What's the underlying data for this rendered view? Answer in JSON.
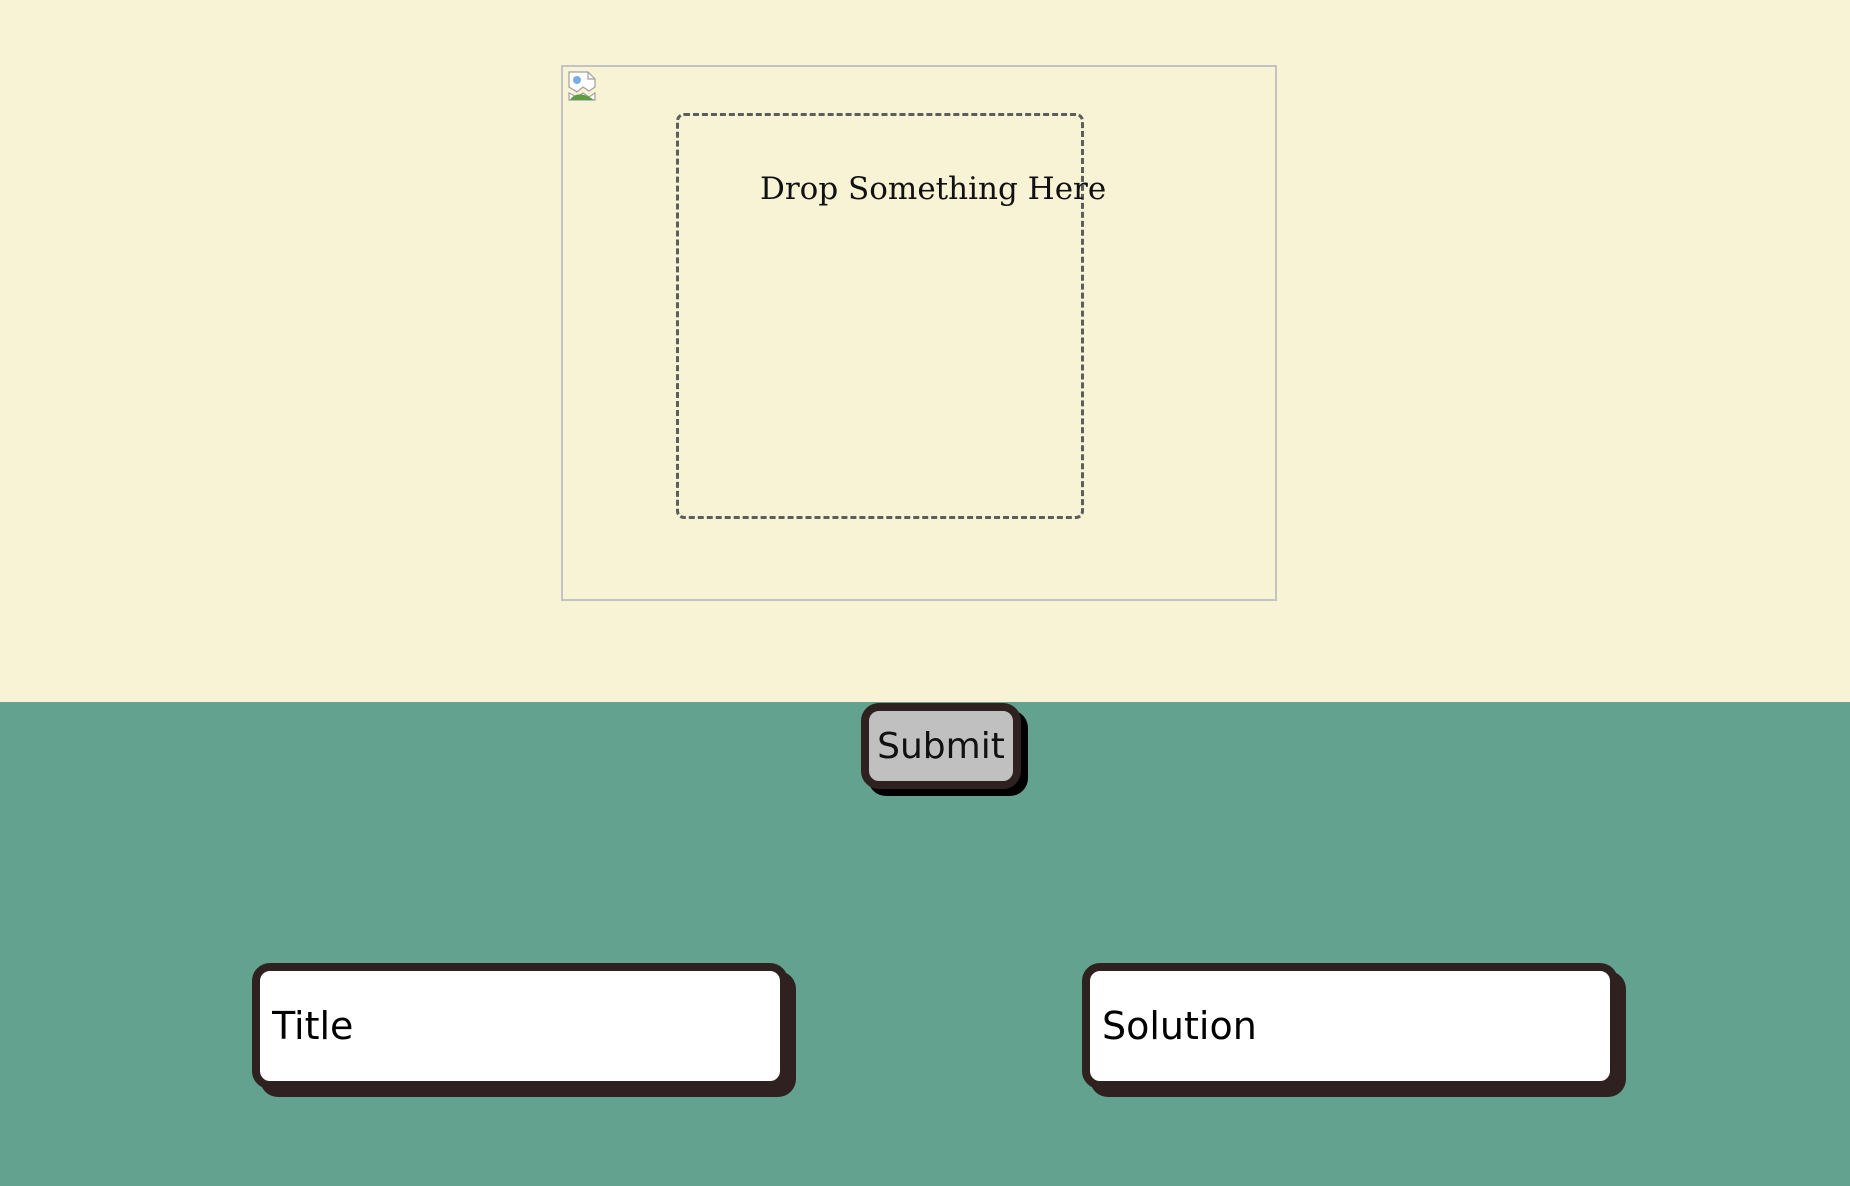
{
  "canvas": {
    "drop_zone_label": "Drop Something Here",
    "broken_image_icon": "broken-image-icon"
  },
  "form": {
    "submit_label": "Submit",
    "title_placeholder": "Title",
    "solution_placeholder": "Solution"
  },
  "colors": {
    "top_background": "#f8f3d5",
    "bottom_background": "#63a28e",
    "button_fill": "#c0c0c0",
    "border_dark": "#2f211f",
    "field_fill": "#ffffff"
  }
}
